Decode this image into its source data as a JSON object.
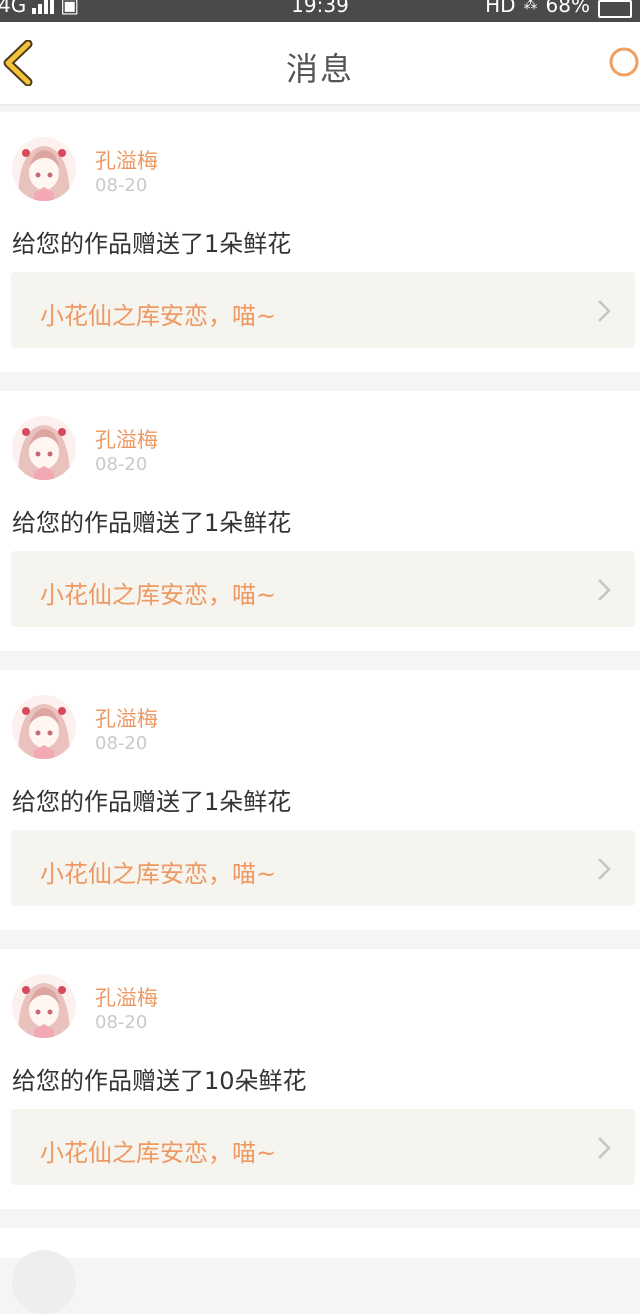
{
  "status": {
    "network": "4G",
    "time": "19:39",
    "hd": "HD",
    "battery": "68%"
  },
  "header": {
    "title": "消息",
    "back_icon": "chevron-left-icon",
    "search_icon": "search-icon",
    "accent": "#f0a020"
  },
  "messages": [
    {
      "sender": "孔溢梅",
      "date": "08-20",
      "text": "给您的作品赠送了1朵鲜花",
      "work_title": "小花仙之库安恋，喵~"
    },
    {
      "sender": "孔溢梅",
      "date": "08-20",
      "text": "给您的作品赠送了1朵鲜花",
      "work_title": "小花仙之库安恋，喵~"
    },
    {
      "sender": "孔溢梅",
      "date": "08-20",
      "text": "给您的作品赠送了1朵鲜花",
      "work_title": "小花仙之库安恋，喵~"
    },
    {
      "sender": "孔溢梅",
      "date": "08-20",
      "text": "给您的作品赠送了10朵鲜花",
      "work_title": "小花仙之库安恋，喵~"
    }
  ],
  "colors": {
    "sender": "#ee9862",
    "date": "#c9c9c9",
    "link_bg": "#f5f4ee"
  }
}
